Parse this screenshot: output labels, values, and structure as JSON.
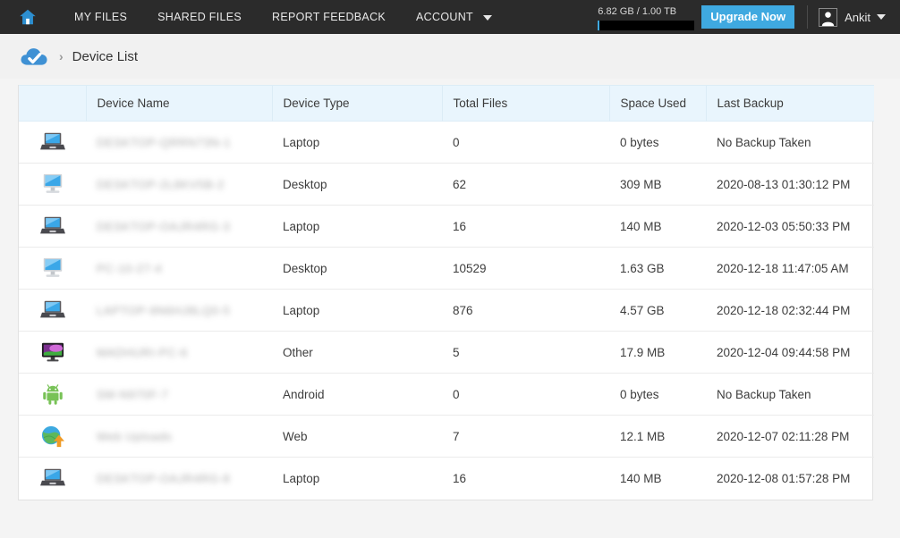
{
  "nav": {
    "home_icon": "home-icon",
    "links": [
      {
        "label": "MY FILES",
        "has_caret": false
      },
      {
        "label": "SHARED FILES",
        "has_caret": false
      },
      {
        "label": "REPORT FEEDBACK",
        "has_caret": false
      },
      {
        "label": "ACCOUNT",
        "has_caret": true
      }
    ],
    "storage": {
      "text": "6.82 GB / 1.00 TB",
      "used": "6.82 GB",
      "total": "1.00 TB",
      "fill_percent": 0.7
    },
    "upgrade_label": "Upgrade Now",
    "account": {
      "user_name": "Ankit",
      "avatar_icon": "user-avatar-icon",
      "caret_icon": "chevron-down-icon"
    }
  },
  "breadcrumb": {
    "cloud_icon": "cloud-check-icon",
    "separator": "›",
    "title": "Device List"
  },
  "table": {
    "columns": [
      "",
      "Device Name",
      "Device Type",
      "Total Files",
      "Space Used",
      "Last Backup"
    ],
    "rows": [
      {
        "icon": "laptop-icon",
        "name": "DESKTOP-QRRN73N-1",
        "type": "Laptop",
        "files": "0",
        "space": "0 bytes",
        "backup": "No Backup Taken"
      },
      {
        "icon": "desktop-icon",
        "name": "DESKTOP-2L8KV5B-2",
        "type": "Desktop",
        "files": "62",
        "space": "309 MB",
        "backup": "2020-08-13 01:30:12 PM"
      },
      {
        "icon": "laptop-icon",
        "name": "DESKTOP-OAJR4RG-3",
        "type": "Laptop",
        "files": "16",
        "space": "140 MB",
        "backup": "2020-12-03 05:50:33 PM"
      },
      {
        "icon": "desktop-icon",
        "name": "PC-10-27-4",
        "type": "Desktop",
        "files": "10529",
        "space": "1.63 GB",
        "backup": "2020-12-18 11:47:05 AM"
      },
      {
        "icon": "laptop-icon",
        "name": "LAPTOP-9N6HJ8LQ0-5",
        "type": "Laptop",
        "files": "876",
        "space": "4.57 GB",
        "backup": "2020-12-18 02:32:44 PM"
      },
      {
        "icon": "other-monitor-icon",
        "name": "MADHURI-PC-6",
        "type": "Other",
        "files": "5",
        "space": "17.9 MB",
        "backup": "2020-12-04 09:44:58 PM"
      },
      {
        "icon": "android-icon",
        "name": "SM-N970F-7",
        "type": "Android",
        "files": "0",
        "space": "0 bytes",
        "backup": "No Backup Taken"
      },
      {
        "icon": "web-upload-icon",
        "name": "Web Uploads",
        "type": "Web",
        "files": "7",
        "space": "12.1 MB",
        "backup": "2020-12-07 02:11:28 PM"
      },
      {
        "icon": "laptop-icon",
        "name": "DESKTOP-OAJR4RG-8",
        "type": "Laptop",
        "files": "16",
        "space": "140 MB",
        "backup": "2020-12-08 01:57:28 PM"
      }
    ]
  },
  "colors": {
    "nav_background": "#2b2b2b",
    "accent_blue": "#3fa9e0",
    "page_background": "#f4f4f4",
    "header_row": "#e9f5fd",
    "table_background": "#ffffff"
  }
}
